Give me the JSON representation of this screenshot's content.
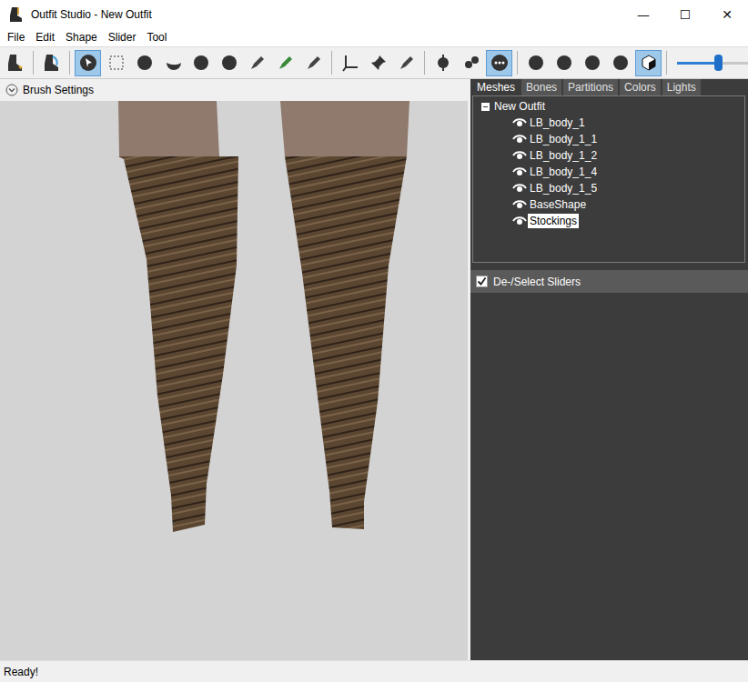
{
  "window": {
    "title": "Outfit Studio - New Outfit",
    "controls": [
      "—",
      "☐",
      "✕"
    ]
  },
  "menu": [
    "File",
    "Edit",
    "Shape",
    "Slider",
    "Tool"
  ],
  "toolbar": {
    "groups": [
      [
        {
          "selected": false
        }
      ],
      [
        {
          "selected": false
        }
      ],
      [
        {
          "selected": true
        },
        {
          "selected": false
        },
        {
          "selected": false
        },
        {
          "selected": false
        },
        {
          "selected": false
        },
        {
          "selected": false
        },
        {
          "selected": false
        },
        {
          "selected": false
        },
        {
          "selected": false
        }
      ],
      [
        {
          "selected": false
        },
        {
          "selected": false
        },
        {
          "selected": false
        }
      ],
      [
        {
          "selected": false
        },
        {
          "selected": false
        },
        {
          "selected": true
        }
      ],
      [
        {
          "selected": false
        },
        {
          "selected": false
        },
        {
          "selected": false
        },
        {
          "selected": false
        },
        {
          "selected": true
        }
      ]
    ],
    "slider": {
      "level": 0.45
    }
  },
  "brush_settings": {
    "label": "Brush Settings",
    "expanded": false
  },
  "tabs": [
    {
      "label": "Meshes",
      "selected": true
    },
    {
      "label": "Bones",
      "selected": false
    },
    {
      "label": "Partitions",
      "selected": false
    },
    {
      "label": "Colors",
      "selected": false
    },
    {
      "label": "Lights",
      "selected": false
    }
  ],
  "tree": {
    "root": "New Outfit",
    "expanded": true,
    "items": [
      {
        "name": "LB_body_1",
        "visible": true,
        "selected": false
      },
      {
        "name": "LB_body_1_1",
        "visible": true,
        "selected": false
      },
      {
        "name": "LB_body_1_2",
        "visible": true,
        "selected": false
      },
      {
        "name": "LB_body_1_4",
        "visible": true,
        "selected": false
      },
      {
        "name": "LB_body_1_5",
        "visible": true,
        "selected": false
      },
      {
        "name": "BaseShape",
        "visible": true,
        "selected": false
      },
      {
        "name": "Stockings",
        "visible": true,
        "selected": true
      }
    ]
  },
  "sliders_header": {
    "label": "De-/Select Sliders",
    "checked": true
  },
  "status_bar": "Ready!"
}
